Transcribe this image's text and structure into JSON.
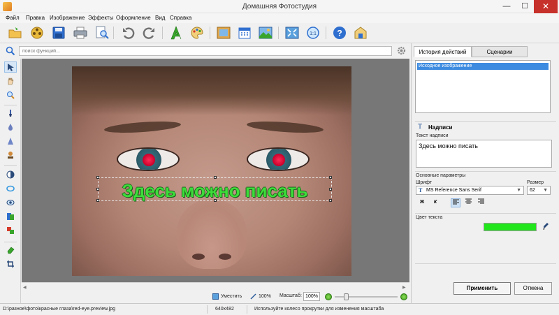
{
  "window": {
    "title": "Домашняя Фотостудия",
    "min": "—",
    "max": "☐",
    "close": "✕"
  },
  "menu": [
    "Файл",
    "Правка",
    "Изображение",
    "Эффекты",
    "Оформление",
    "Вид",
    "Справка"
  ],
  "toolbar": {
    "icons": [
      "open-folder-icon",
      "film-reel-icon",
      "save-icon",
      "print-icon",
      "print-preview-icon",
      "undo-icon",
      "redo-icon",
      "text-tool-icon",
      "palette-icon",
      "frame-icon",
      "calendar-icon",
      "collage-icon",
      "fit-screen-icon",
      "actual-size-icon",
      "help-icon",
      "home-box-icon"
    ]
  },
  "search": {
    "placeholder": "поиск функций..."
  },
  "tools": [
    "pointer-icon",
    "hand-icon",
    "zoom-icon",
    "brush-icon",
    "drop-icon",
    "cone-icon",
    "stamp-icon",
    "contrast-icon",
    "lens-icon",
    "eye-icon",
    "layers-icon",
    "color-swap-icon",
    "eraser-icon",
    "crop-icon"
  ],
  "canvas": {
    "caption": "Здесь можно писать",
    "caption_color": "#3ddc3a"
  },
  "zoombar": {
    "fit": "Уместить",
    "actual": "100%",
    "scale_label": "Масштаб:",
    "scale_value": "100%"
  },
  "panel": {
    "tabs": [
      "История действий",
      "Сценарии"
    ],
    "history": [
      "Исходное изображение"
    ],
    "section_title": "Надписи",
    "text_label": "Текст надписи",
    "text_value": "Здесь можно писать",
    "params_label": "Основные параметры",
    "font_label": "Шрифт",
    "font_value": "MS Reference Sans Serif",
    "size_label": "Размер",
    "size_value": "62",
    "bold": "Ж",
    "italic": "К",
    "color_label": "Цвет текста",
    "text_color": "#22e61c",
    "apply": "Применить",
    "cancel": "Отмена"
  },
  "status": {
    "path": "D:\\разное\\фото\\красные глаза\\red-eye.preview.jpg",
    "dimensions": "640x482",
    "hint": "Используйте колесо прокрутки для изменения масштаба"
  }
}
